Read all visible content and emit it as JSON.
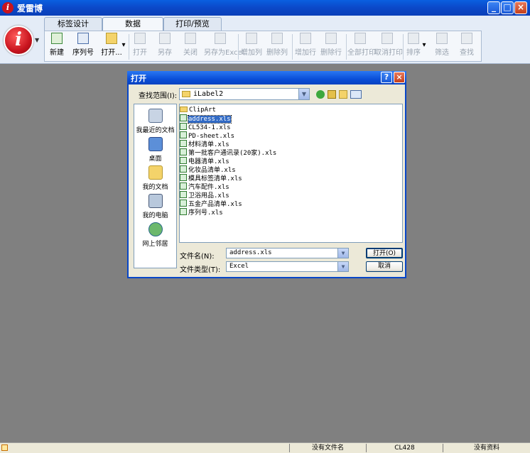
{
  "window": {
    "title": "爱雷博",
    "app_icon": "app-logo-icon"
  },
  "ribbon": {
    "tabs": [
      {
        "label": "标签设计",
        "active": false
      },
      {
        "label": "数据",
        "active": true
      },
      {
        "label": "打印/预览",
        "active": false
      }
    ],
    "buttons": {
      "new": "新建",
      "serial": "序列号",
      "open": "打开...",
      "open_disabled": "打开",
      "save_as": "另存",
      "close": "关闭",
      "save_as_excel": "另存为Excel",
      "add_column": "增加列",
      "delete_column": "删除列",
      "add_row": "增加行",
      "delete_row": "删除行",
      "print_all": "全部打印",
      "cancel_print": "取消打印",
      "sort": "排序",
      "filter": "筛选",
      "find": "查找"
    }
  },
  "dialog": {
    "title": "打开",
    "look_in_label": "查找范围(I):",
    "look_in_value": "iLabel2",
    "places": [
      "我最近的文档",
      "桌面",
      "我的文档",
      "我的电脑",
      "网上邻居"
    ],
    "files": [
      {
        "name": "ClipArt",
        "type": "folder",
        "selected": false
      },
      {
        "name": "address.xls",
        "type": "xls",
        "selected": true
      },
      {
        "name": "CL534-1.xls",
        "type": "xls",
        "selected": false
      },
      {
        "name": "PD-sheet.xls",
        "type": "xls",
        "selected": false
      },
      {
        "name": "材料清单.xls",
        "type": "xls",
        "selected": false
      },
      {
        "name": "第一批客户通讯录(20家).xls",
        "type": "xls",
        "selected": false
      },
      {
        "name": "电器清单.xls",
        "type": "xls",
        "selected": false
      },
      {
        "name": "化妆品清单.xls",
        "type": "xls",
        "selected": false
      },
      {
        "name": "模具标签清单.xls",
        "type": "xls",
        "selected": false
      },
      {
        "name": "汽车配件.xls",
        "type": "xls",
        "selected": false
      },
      {
        "name": "卫浴用品.xls",
        "type": "xls",
        "selected": false
      },
      {
        "name": "五金产品清单.xls",
        "type": "xls",
        "selected": false
      },
      {
        "name": "序列号.xls",
        "type": "xls",
        "selected": false
      }
    ],
    "filename_label": "文件名(N):",
    "filename_value": "address.xls",
    "filetype_label": "文件类型(T):",
    "filetype_value": "Excel",
    "open_button": "打开(O)",
    "cancel_button": "取消"
  },
  "statusbar": {
    "filename": "没有文件名",
    "printer": "CL428",
    "data": "没有资料"
  },
  "colors": {
    "titlebar": "#0b48c8",
    "ribbon_bg": "#e4ecf7",
    "workspace": "#808080",
    "dialog_bg": "#ece9d8",
    "selection": "#316ac5"
  }
}
